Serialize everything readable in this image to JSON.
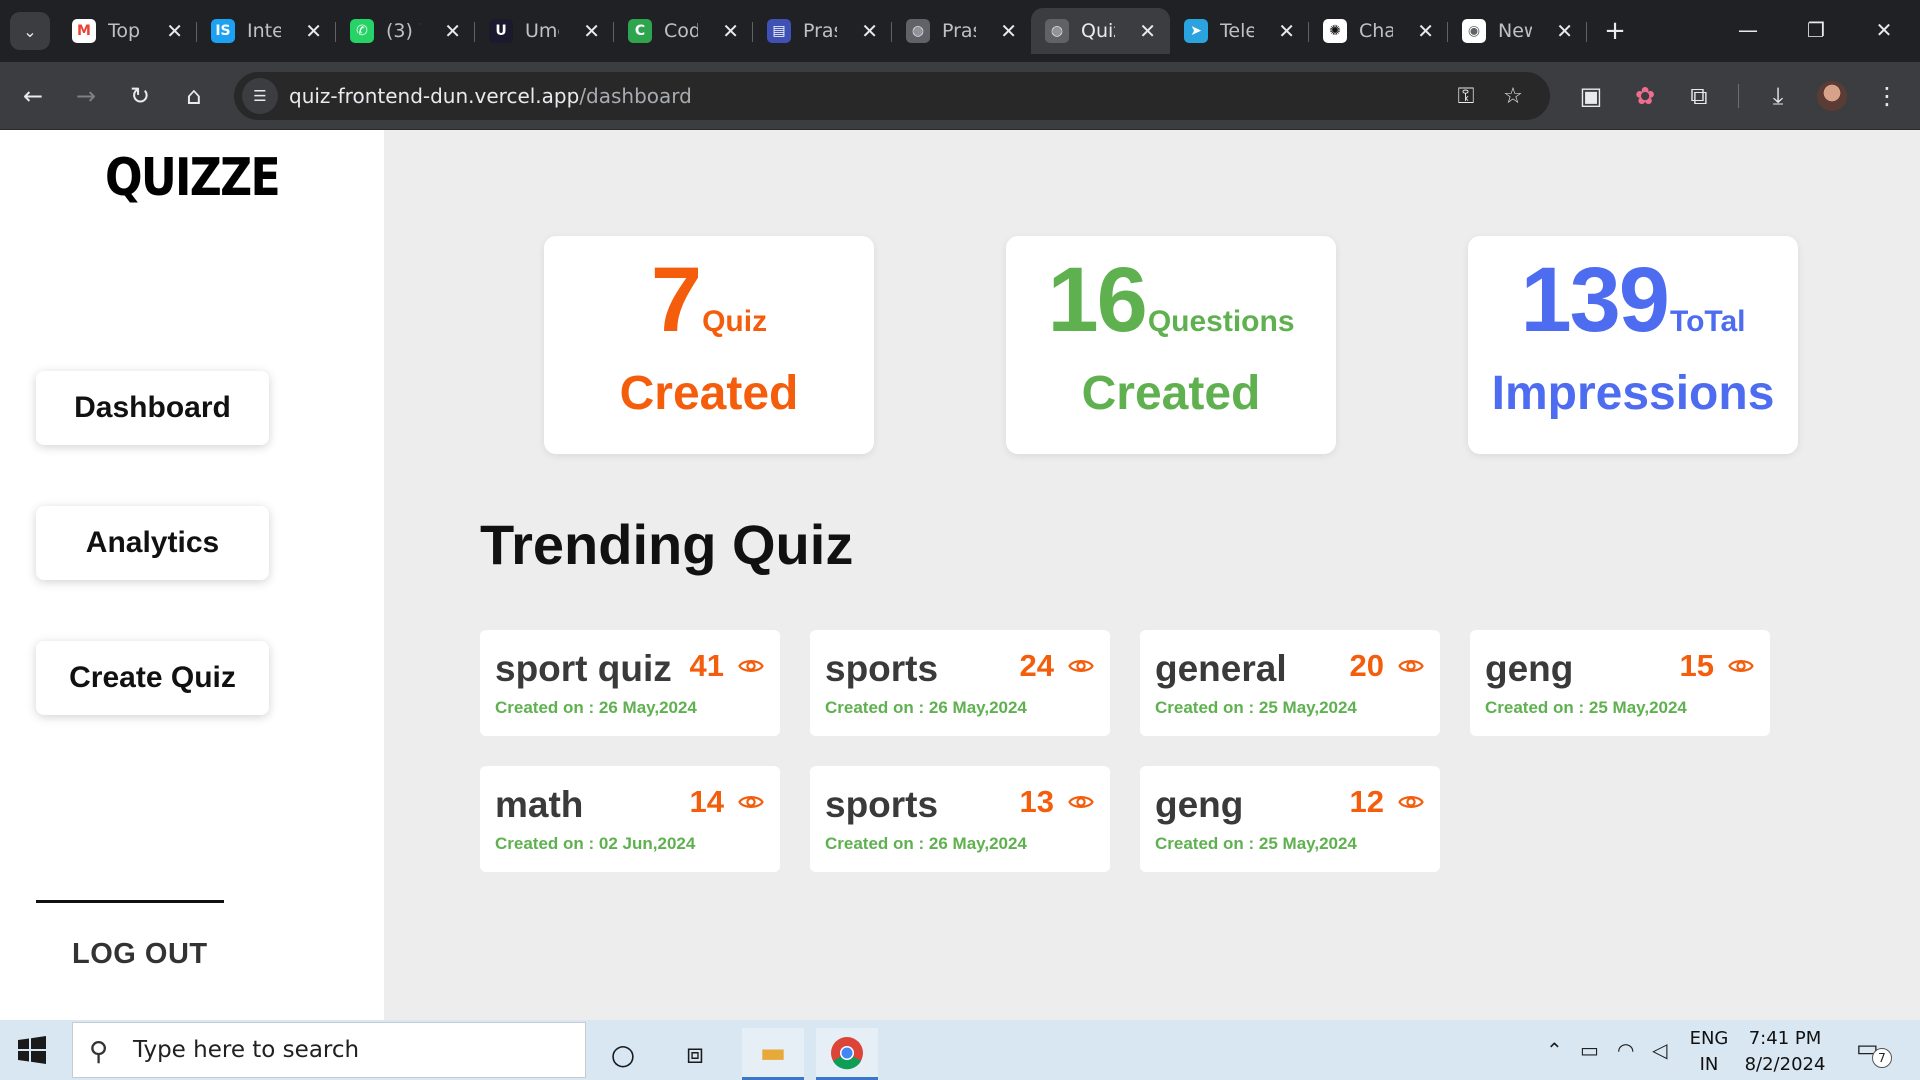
{
  "browser": {
    "tabs": [
      {
        "title": "Top",
        "icon": "gmail-icon"
      },
      {
        "title": "Inter",
        "icon": "is-icon"
      },
      {
        "title": "(3) W",
        "icon": "whatsapp-icon"
      },
      {
        "title": "Ume",
        "icon": "ume-icon"
      },
      {
        "title": "Cod",
        "icon": "code-icon"
      },
      {
        "title": "Pras",
        "icon": "form-icon"
      },
      {
        "title": "Pras",
        "icon": "globe-icon"
      },
      {
        "title": "Quiz",
        "icon": "globe-icon",
        "active": true
      },
      {
        "title": "Teleg",
        "icon": "telegram-icon"
      },
      {
        "title": "Cha",
        "icon": "chatgpt-icon"
      },
      {
        "title": "New",
        "icon": "chrome-icon"
      }
    ],
    "url_host": "quiz-frontend-dun.vercel.app",
    "url_path": "/dashboard"
  },
  "sidebar": {
    "logo": "QUIZZE",
    "nav": [
      "Dashboard",
      "Analytics",
      "Create Quiz"
    ],
    "logout": "LOG OUT"
  },
  "stats": [
    {
      "value": "7",
      "unit": "Quiz",
      "label": "Created",
      "color": "#f35d0b"
    },
    {
      "value": "16",
      "unit": "Questions",
      "label": "Created",
      "color": "#5fb150"
    },
    {
      "value": "139",
      "unit": "ToTal",
      "label": "Impressions",
      "color": "#4d6cf0"
    }
  ],
  "trending": {
    "title": "Trending Quiz",
    "date_prefix": "Created on : ",
    "items": [
      {
        "name": "sport quiz",
        "count": "41",
        "date": "26 May,2024"
      },
      {
        "name": "sports",
        "count": "24",
        "date": "26 May,2024"
      },
      {
        "name": "general",
        "count": "20",
        "date": "25 May,2024"
      },
      {
        "name": "geng",
        "count": "15",
        "date": "25 May,2024"
      },
      {
        "name": "math",
        "count": "14",
        "date": "02 Jun,2024"
      },
      {
        "name": "sports",
        "count": "13",
        "date": "26 May,2024"
      },
      {
        "name": "geng",
        "count": "12",
        "date": "25 May,2024"
      }
    ]
  },
  "taskbar": {
    "search_placeholder": "Type here to search",
    "lang_top": "ENG",
    "lang_bottom": "IN",
    "time": "7:41 PM",
    "date": "8/2/2024",
    "notifications": "7"
  }
}
